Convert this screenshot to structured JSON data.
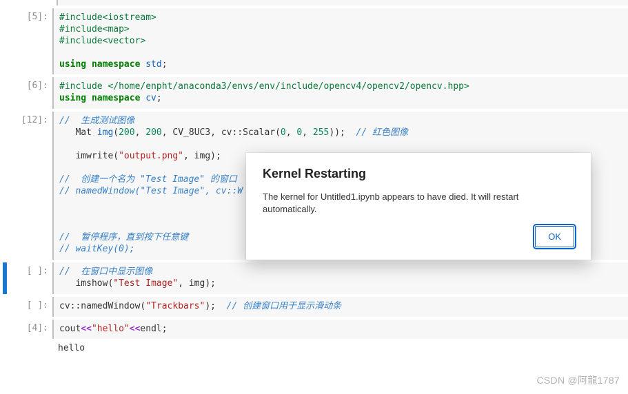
{
  "cells": {
    "c5": {
      "prompt": "[5]:",
      "l0": "#include<iostream>",
      "l1": "#include<map>",
      "l2": "#include<vector>",
      "kw": "using namespace",
      "ns": "std",
      "semi": ";"
    },
    "c6": {
      "prompt": "[6]:",
      "inc": "#include </home/enpht/anaconda3/envs/env/include/opencv4/opencv2/opencv.hpp>",
      "kw": "using namespace",
      "ns": "cv",
      "semi": ";"
    },
    "c12": {
      "prompt": "[12]:",
      "c1": "//  生成测试图像",
      "pre": "   Mat ",
      "img": "img",
      "open": "(",
      "n1": "200",
      "cm": ", ",
      "n2": "200",
      "rest1": ", CV_8UC3, cv::Scalar(",
      "z1": "0",
      "z2": "0",
      "z3": "255",
      "close1": "));  ",
      "cend": "// 红色图像",
      "l4a": "   imwrite(",
      "l4s": "\"output.png\"",
      "l4b": ", img);",
      "c5a": "//  创建一个名为 \"Test Image\" 的窗口",
      "c5b": "// namedWindow(\"Test Image\", cv::W",
      "c8": "//  暂停程序，直到按下任意键",
      "c9": "// waitKey(0);"
    },
    "ce1": {
      "prompt": "[ ]:",
      "c": "//  在窗口中显示图像",
      "a": "   imshow(",
      "s": "\"Test Image\"",
      "b": ", img);"
    },
    "ce2": {
      "prompt": "[ ]:",
      "a": "cv::namedWindow(",
      "s": "\"Trackbars\"",
      "b": ");  ",
      "c": "// 创建窗口用于显示滑动条"
    },
    "c4": {
      "prompt": "[4]:",
      "a": "cout",
      "op1": "<<",
      "s": "\"hello\"",
      "op2": "<<",
      "b": "endl;",
      "out": "hello"
    }
  },
  "dialog": {
    "title": "Kernel Restarting",
    "body": "The kernel for Untitled1.ipynb appears to have died. It will restart automatically.",
    "ok": "OK"
  },
  "watermark": "CSDN @阿龍1787"
}
